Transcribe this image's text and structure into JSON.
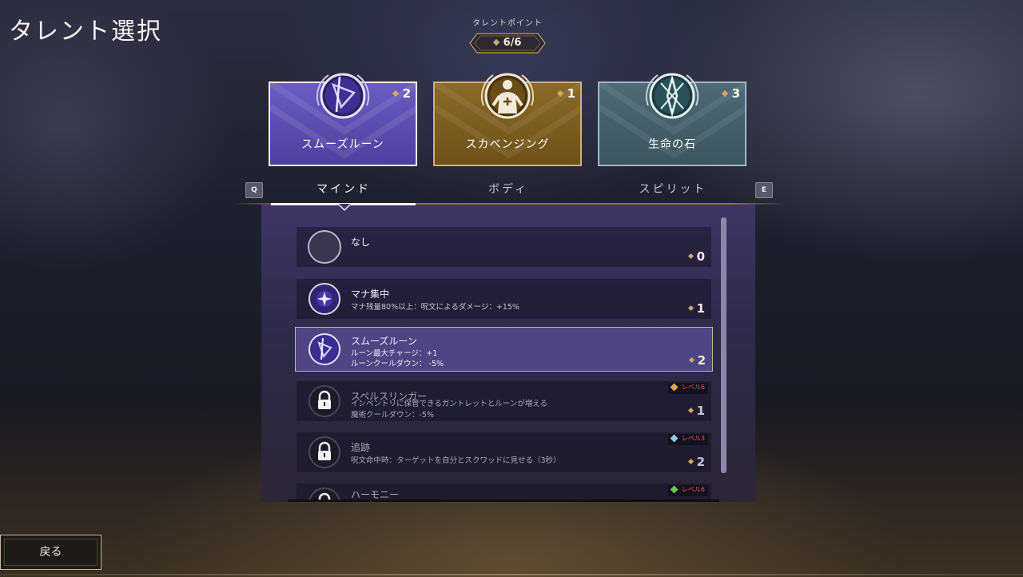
{
  "page": {
    "title": "タレント選択"
  },
  "talent_points": {
    "label": "タレントポイント",
    "value": "6/6"
  },
  "categories": [
    {
      "name": "スムーズルーン",
      "cost": "2",
      "icon": "smooth-rune-icon",
      "color": "#5848a8"
    },
    {
      "name": "スカベンジング",
      "cost": "1",
      "icon": "scavenging-icon",
      "color": "#7a5a1e"
    },
    {
      "name": "生命の石",
      "cost": "3",
      "icon": "life-stone-icon",
      "color": "#44606a"
    }
  ],
  "tabs": {
    "prev_key": "Q",
    "next_key": "E",
    "items": [
      "マインド",
      "ボディ",
      "スピリット"
    ],
    "active": "マインド"
  },
  "talents": [
    {
      "name": "なし",
      "desc1": "",
      "desc2": "",
      "cost": "0",
      "icon": "empty-slot-icon",
      "locked": false
    },
    {
      "name": "マナ集中",
      "desc1": "マナ残量80%以上：呪文によるダメージ：+15%",
      "desc2": "",
      "cost": "1",
      "icon": "mana-star-icon",
      "locked": false
    },
    {
      "name": "スムーズルーン",
      "desc1": "ルーン最大チャージ：+1",
      "desc2": "ルーンクールダウン： -5%",
      "cost": "2",
      "icon": "smooth-rune-icon",
      "locked": false,
      "selected": true
    },
    {
      "name": "スペルスリンガー",
      "desc1": "インベントリに保管できるガントレットとルーンが増える",
      "desc2": "魔術クールダウン：-5%",
      "cost": "1",
      "icon": "lock-icon",
      "locked": true,
      "level": "レベル6",
      "level_color": "#d8a84a"
    },
    {
      "name": "追跡",
      "desc1": "呪文命中時：ターゲットを自分とスクワッドに見せる（3秒）",
      "desc2": "",
      "cost": "2",
      "icon": "lock-icon",
      "locked": true,
      "level": "レベル3",
      "level_color": "#8ec8e8"
    },
    {
      "name": "ハーモニー",
      "desc1": "",
      "desc2": "",
      "cost": "",
      "icon": "lock-icon",
      "locked": true,
      "level": "レベル6",
      "level_color": "#6ac84a"
    }
  ],
  "footer": {
    "back_label": "戻る"
  }
}
